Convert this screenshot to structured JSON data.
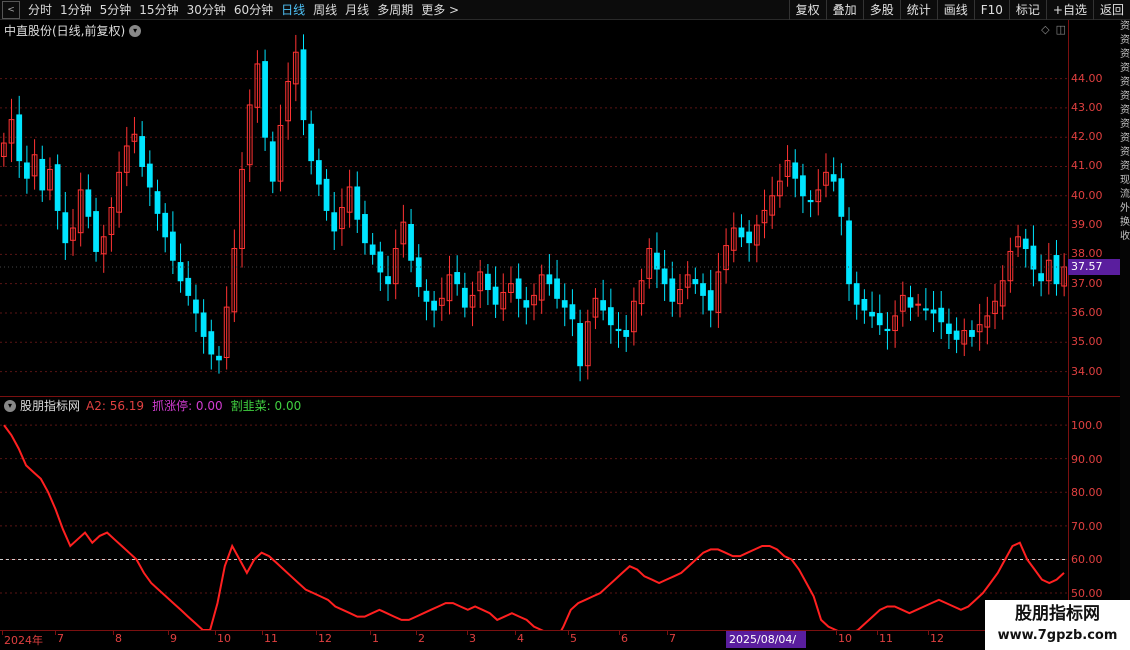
{
  "toolbar": {
    "back_icon": "left-arrow-icon",
    "periods": [
      "分时",
      "1分钟",
      "5分钟",
      "15分钟",
      "30分钟",
      "60分钟",
      "日线",
      "周线",
      "月线",
      "多周期",
      "更多 >"
    ],
    "active_period": "日线",
    "actions": [
      "复权",
      "叠加",
      "多股",
      "统计",
      "画线",
      "F10",
      "标记",
      "+自选",
      "返回"
    ]
  },
  "main": {
    "title": "中直股份(日线,前复权)",
    "current_price": "37.57",
    "price_axis": [
      "44.00",
      "43.00",
      "42.00",
      "41.00",
      "40.00",
      "39.00",
      "38.00",
      "37.00",
      "36.00",
      "35.00",
      "34.00"
    ]
  },
  "indicator": {
    "name": "股朋指标网",
    "a2": "A2: 56.19",
    "zt": "抓涨停: 0.00",
    "gj": "割韭菜: 0.00",
    "axis": [
      "100.0",
      "90.00",
      "80.00",
      "70.00",
      "60.00",
      "50.00"
    ]
  },
  "date_axis": {
    "labels": [
      "2024年",
      "7",
      "8",
      "9",
      "10",
      "11",
      "12",
      "1",
      "2",
      "3",
      "4",
      "5",
      "6",
      "7",
      "10",
      "11",
      "12"
    ],
    "cursor": "2025/08/04/—"
  },
  "right_strip": [
    "资",
    "资",
    "资",
    "资",
    "资",
    "资",
    "资",
    "资",
    "资",
    "资",
    "资",
    "现",
    "流",
    "外",
    "换",
    "收"
  ],
  "watermark": {
    "title": "股朋指标网",
    "url": "www.7gpzb.com"
  },
  "colors": {
    "up": "#ff3333",
    "down": "#00e5ff",
    "line": "#ff2020",
    "axis": "#e04040",
    "grid": "#5a1414",
    "accent": "#5a1e9e"
  },
  "chart_data": [
    {
      "type": "candlestick",
      "title": "中直股份(日线,前复权)",
      "ylim": [
        33.2,
        46.0
      ],
      "close": [
        41.8,
        42.6,
        41.2,
        40.6,
        41.4,
        40.2,
        40.9,
        39.5,
        38.4,
        38.9,
        40.2,
        39.3,
        38.1,
        38.6,
        39.6,
        40.8,
        41.7,
        42.1,
        41.0,
        40.3,
        39.4,
        38.6,
        37.8,
        37.1,
        36.6,
        36.0,
        35.2,
        34.6,
        34.4,
        36.2,
        38.2,
        40.9,
        43.1,
        44.5,
        42.0,
        40.5,
        42.4,
        43.9,
        44.9,
        42.6,
        41.2,
        40.4,
        39.5,
        38.8,
        39.6,
        40.3,
        39.2,
        38.4,
        38.0,
        37.4,
        37.0,
        38.2,
        39.1,
        37.8,
        36.9,
        36.4,
        36.1,
        36.5,
        37.3,
        37.0,
        36.2,
        36.6,
        37.4,
        36.8,
        36.3,
        36.7,
        37.0,
        36.5,
        36.2,
        36.6,
        37.3,
        37.0,
        36.5,
        36.2,
        35.8,
        34.2,
        35.7,
        36.5,
        36.1,
        35.6,
        35.4,
        35.2,
        36.4,
        37.1,
        38.2,
        37.5,
        37.0,
        36.4,
        36.8,
        37.3,
        37.0,
        36.6,
        36.1,
        37.4,
        38.3,
        38.9,
        38.6,
        38.4,
        39.0,
        39.5,
        40.0,
        40.5,
        41.2,
        40.6,
        40.0,
        39.8,
        40.2,
        40.8,
        40.5,
        39.3,
        37.0,
        36.3,
        36.1,
        35.9,
        35.6,
        35.4,
        35.9,
        36.6,
        36.2,
        36.3,
        36.1,
        36.0,
        35.7,
        35.3,
        35.1,
        35.4,
        35.2,
        35.6,
        35.9,
        36.4,
        37.1,
        38.1,
        38.6,
        38.2,
        37.5,
        37.1,
        37.8,
        37.0,
        37.57
      ],
      "current": 37.57
    },
    {
      "type": "line",
      "series": [
        {
          "name": "A2",
          "values": [
            100,
            97,
            93,
            88,
            86,
            84,
            80,
            75,
            69,
            64,
            66,
            68,
            65,
            67,
            68,
            66,
            64,
            62,
            60,
            56,
            53,
            51,
            49,
            47,
            45,
            43,
            41,
            39,
            39,
            47,
            58,
            64,
            60,
            56,
            60,
            62,
            61,
            59,
            57,
            55,
            53,
            51,
            50,
            49,
            48,
            46,
            45,
            44,
            43,
            43,
            44,
            45,
            44,
            43,
            42,
            42,
            43,
            44,
            45,
            46,
            47,
            47,
            46,
            45,
            46,
            45,
            44,
            42,
            43,
            44,
            43,
            42,
            40,
            39,
            38,
            36,
            40,
            45,
            47,
            48,
            49,
            50,
            52,
            54,
            56,
            58,
            57,
            55,
            54,
            53,
            54,
            55,
            56,
            58,
            60,
            62,
            63,
            63,
            62,
            61,
            61,
            62,
            63,
            64,
            64,
            63,
            61,
            60,
            57,
            53,
            49,
            42,
            40,
            39,
            38,
            38,
            39,
            41,
            43,
            45,
            46,
            46,
            45,
            44,
            45,
            46,
            47,
            48,
            47,
            46,
            45,
            46,
            48,
            50,
            53,
            56,
            60,
            64,
            65,
            60,
            57,
            54,
            53,
            54,
            56
          ]
        }
      ],
      "ylim": [
        39,
        103
      ],
      "reference_line": 60
    }
  ]
}
